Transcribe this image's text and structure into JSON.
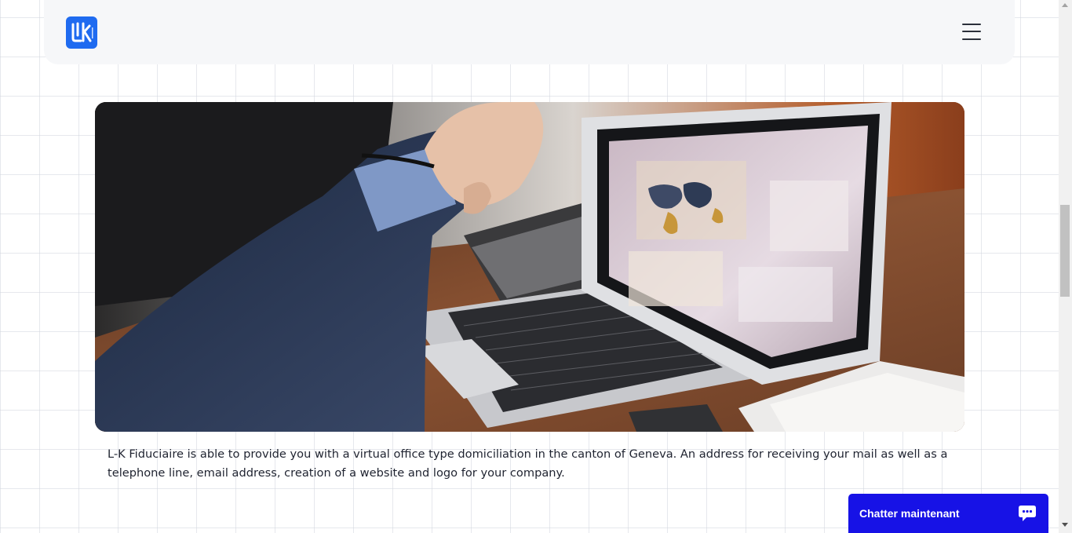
{
  "header": {
    "logo_text": "LK",
    "logo_alt": "L-K Fiduciaire",
    "menu_icon": "hamburger-menu-icon"
  },
  "hero": {
    "image_alt": "Hands working on a laptop showing a world map dashboard"
  },
  "content": {
    "description": "L-K Fiduciaire is able to provide you with a virtual office type domiciliation in the canton of Geneva. An address for receiving your mail as well as a telephone line, email address, creation of a website and logo for your company."
  },
  "chat": {
    "label": "Chatter maintenant",
    "icon": "chat-bubble-icon",
    "color": "#1712e6"
  },
  "colors": {
    "brand": "#1f6bf0",
    "header_bg": "#f6f7f9",
    "text": "#1f2330"
  }
}
